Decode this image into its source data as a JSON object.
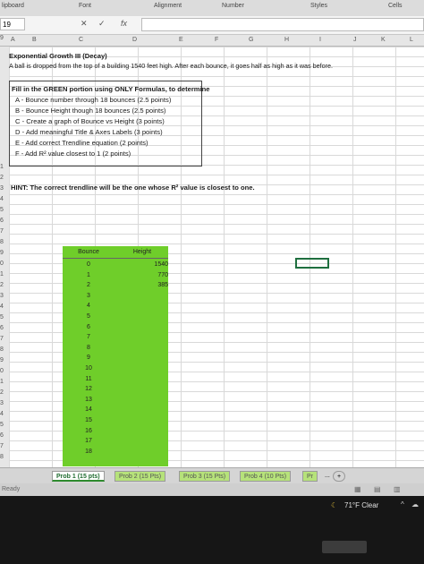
{
  "ribbon": {
    "groups": [
      "lipboard",
      "Font",
      "Alignment",
      "Number",
      "Styles",
      "Cells"
    ]
  },
  "formula_bar": {
    "name_box": "19",
    "cancel": "✕",
    "enter": "✓",
    "fx": "fx",
    "value": ""
  },
  "columns": [
    "A",
    "B",
    "C",
    "D",
    "E",
    "F",
    "G",
    "H",
    "I",
    "J",
    "K",
    "L"
  ],
  "rows": [
    "9",
    "1",
    "2",
    "3",
    "4",
    "5",
    "6",
    "7",
    "8",
    "9",
    "0",
    "1",
    "2",
    "3",
    "4",
    "5",
    "6",
    "7",
    "8",
    "9",
    "0",
    "1",
    "2",
    "3",
    "4",
    "5",
    "6",
    "7",
    "8"
  ],
  "problem": {
    "title": "Exponential Growth III (Decay)",
    "description": "A ball is dropped from the top of a building 1540 feet high. After each bounce, it goes half as high as it was before.",
    "instructions_heading": "Fill in the GREEN portion using ONLY Formulas, to determine",
    "tasks": [
      "A - Bounce number through 18 bounces (2.5 points)",
      "B - Bounce Height though 18 bounces (2.5 points)",
      "C - Create a graph of Bounce vs Height (3 points)",
      "D - Add meaningful Title & Axes Labels (3 points)",
      "E - Add correct Trendline equation (2 points)",
      "F - Add R² value closest to 1 (2 points)"
    ],
    "hint": "HINT: The correct trendline will be the one whose R² value is closest to one."
  },
  "table": {
    "headers": [
      "Bounce",
      "Height"
    ],
    "rows": [
      [
        "0",
        "1540"
      ],
      [
        "1",
        "770"
      ],
      [
        "2",
        "385"
      ],
      [
        "3",
        ""
      ],
      [
        "4",
        ""
      ],
      [
        "5",
        ""
      ],
      [
        "6",
        ""
      ],
      [
        "7",
        ""
      ],
      [
        "8",
        ""
      ],
      [
        "9",
        ""
      ],
      [
        "10",
        ""
      ],
      [
        "11",
        ""
      ],
      [
        "12",
        ""
      ],
      [
        "13",
        ""
      ],
      [
        "14",
        ""
      ],
      [
        "15",
        ""
      ],
      [
        "16",
        ""
      ],
      [
        "17",
        ""
      ],
      [
        "18",
        ""
      ]
    ]
  },
  "sheet_tabs": [
    "Prob 1 (15 pts)",
    "Prob 2 (15 Pts)",
    "Prob 3 (15 Pts)",
    "Prob 4 (10 Pts)",
    "Pr"
  ],
  "tab_ellipsis": "...",
  "status": "Ready",
  "taskbar": {
    "weather": "71°F Clear"
  },
  "colors": {
    "green_fill": "#6fce2a",
    "selection_border": "#1f6f3f",
    "tab_green": "#b6e27a"
  }
}
